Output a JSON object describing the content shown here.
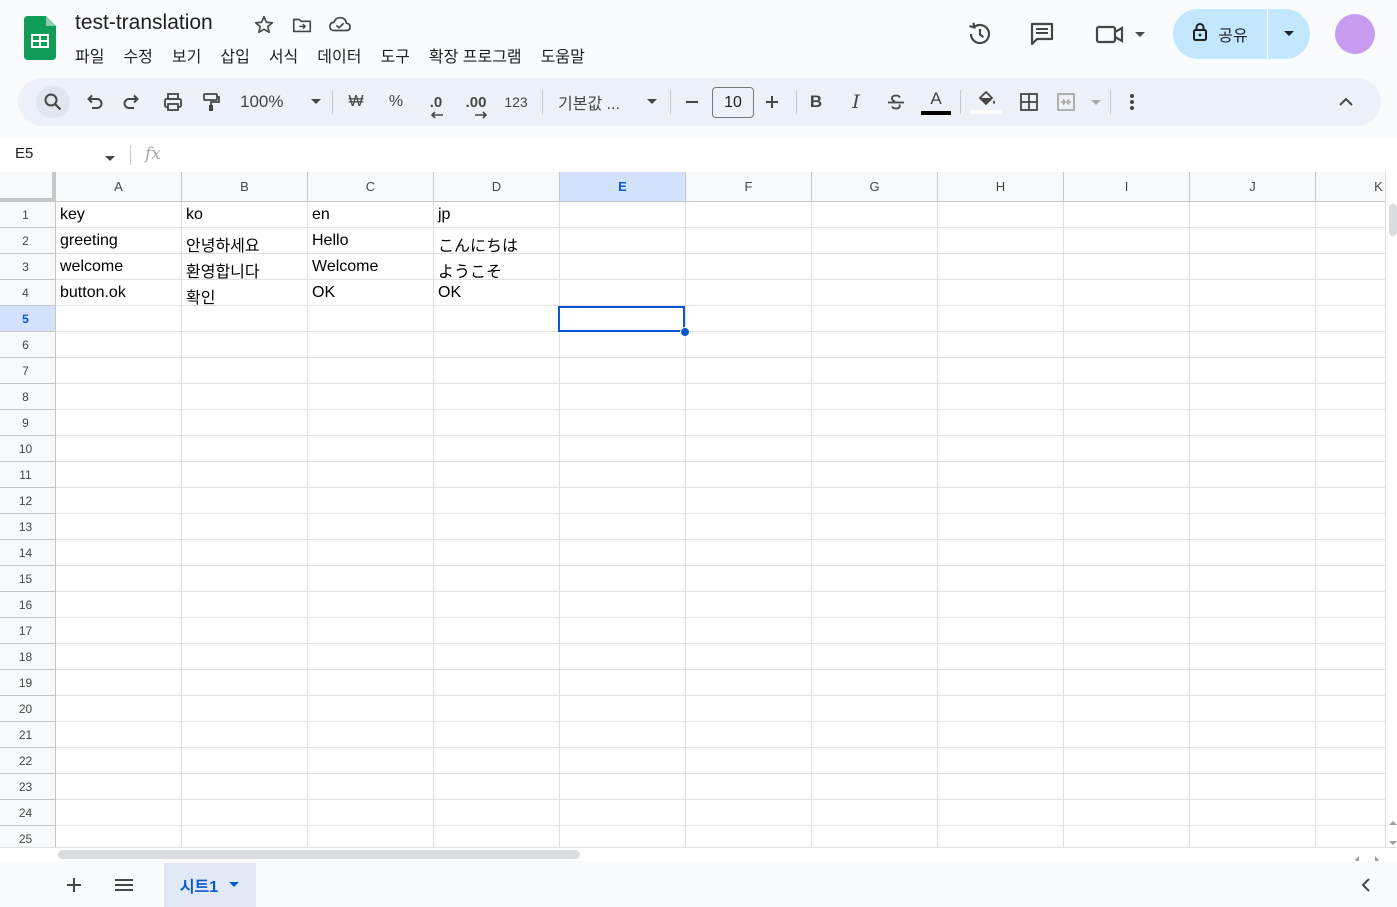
{
  "app": {
    "doc_title": "test-translation",
    "menu": [
      "파일",
      "수정",
      "보기",
      "삽입",
      "서식",
      "데이터",
      "도구",
      "확장 프로그램",
      "도움말"
    ],
    "share_label": "공유"
  },
  "toolbar": {
    "zoom": "100%",
    "currency": "₩",
    "percent": "%",
    "dec_decrease": ".0",
    "dec_increase": ".00",
    "number_format": "123",
    "font_family": "기본값 ...",
    "font_size": "10",
    "bold": "B",
    "italic": "I",
    "text_color": "A"
  },
  "formula_bar": {
    "name_box": "E5",
    "fx": "fx"
  },
  "grid": {
    "columns": [
      "A",
      "B",
      "C",
      "D",
      "E",
      "F",
      "G",
      "H",
      "I",
      "J",
      "K"
    ],
    "selected_column": "E",
    "selected_row": 5,
    "rows": [
      [
        "key",
        "ko",
        "en",
        "jp"
      ],
      [
        "greeting",
        "안녕하세요",
        "Hello",
        "こんにちは"
      ],
      [
        "welcome",
        "환영합니다",
        "Welcome",
        "ようこそ"
      ],
      [
        "button.ok",
        "확인",
        "OK",
        "OK"
      ]
    ],
    "row_count": 25
  },
  "sheets": {
    "active_tab": "시트1"
  },
  "colors": {
    "accent": "#0b57d0",
    "share_bg": "#c2e7ff",
    "avatar": "#c79cf0",
    "logo_green": "#0f9d58"
  }
}
